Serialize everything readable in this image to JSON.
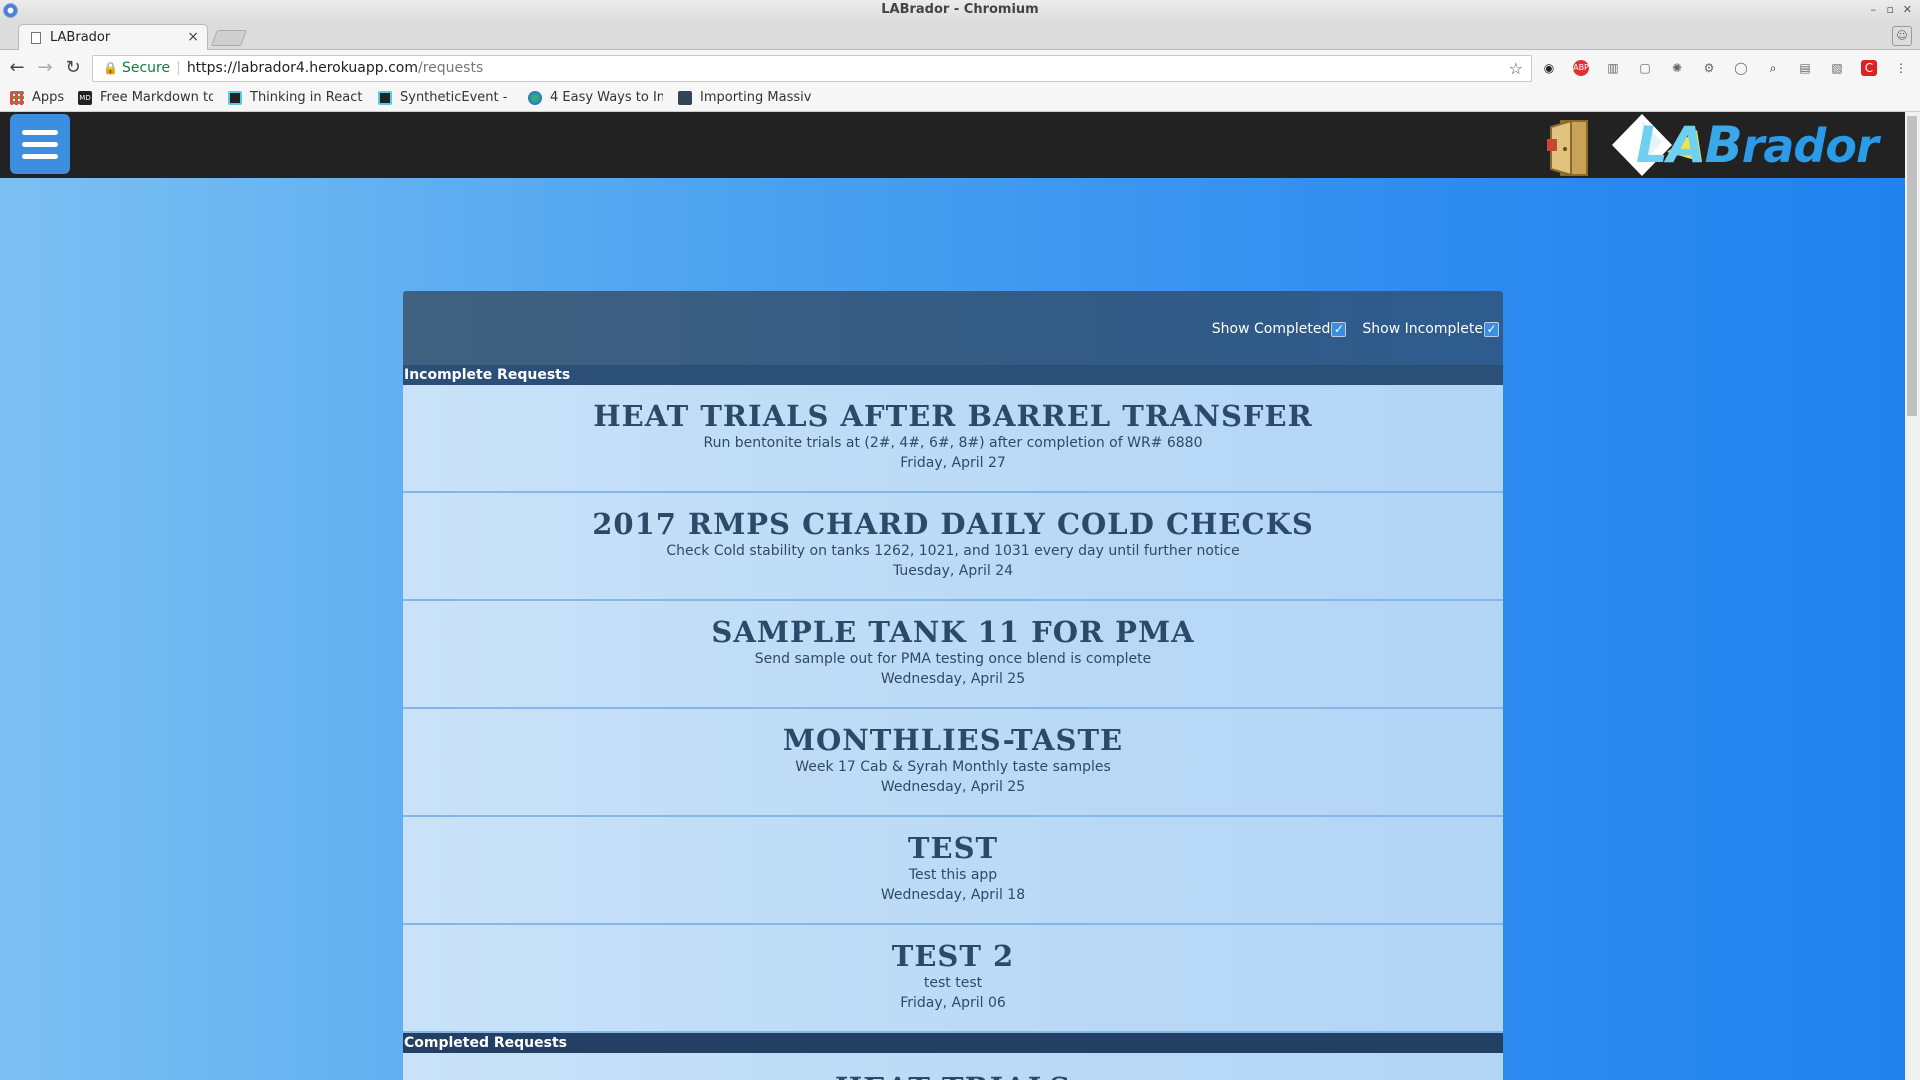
{
  "window": {
    "title": "LABrador - Chromium",
    "controls": [
      "–",
      "▫",
      "✕"
    ]
  },
  "tab": {
    "title": "LABrador",
    "close": "×"
  },
  "address_bar": {
    "secure_label": "Secure",
    "url_host": "https://labrador4.herokuapp.com",
    "url_path": "/requests"
  },
  "bookmarks": {
    "apps": "Apps",
    "items": [
      "Free Markdown to",
      "Thinking in React",
      "SyntheticEvent -",
      "4 Easy Ways to In",
      "Importing Massiv"
    ]
  },
  "app": {
    "logo": {
      "la": "LA",
      "b": "B",
      "rador": "rador"
    },
    "filters": {
      "show_completed": {
        "label": "Show Completed",
        "checked": true
      },
      "show_incomplete": {
        "label": "Show Incomplete",
        "checked": true
      }
    },
    "sections": {
      "incomplete": "Incomplete Requests",
      "completed": "Completed Requests"
    },
    "incomplete_requests": [
      {
        "title": "HEAT TRIALS AFTER BARREL TRANSFER",
        "description": "Run bentonite trials at (2#, 4#, 6#, 8#) after completion of WR# 6880",
        "date": "Friday, April 27"
      },
      {
        "title": "2017 RMPS CHARD DAILY COLD CHECKS",
        "description": "Check Cold stability on tanks 1262, 1021, and 1031 every day until further notice",
        "date": "Tuesday, April 24"
      },
      {
        "title": "SAMPLE TANK 11 FOR PMA",
        "description": "Send sample out for PMA testing once blend is complete",
        "date": "Wednesday, April 25"
      },
      {
        "title": "MONTHLIES-TASTE",
        "description": "Week 17 Cab & Syrah Monthly taste samples",
        "date": "Wednesday, April 25"
      },
      {
        "title": "TEST",
        "description": "Test this app",
        "date": "Wednesday, April 18"
      },
      {
        "title": "TEST 2",
        "description": "test test",
        "date": "Friday, April 06"
      }
    ],
    "completed_requests": [
      {
        "title": "HEAT TRIALS"
      }
    ]
  },
  "colors": {
    "accent": "#3d8ee0",
    "header": "#222222",
    "panel_dark": "#2c4f78"
  }
}
